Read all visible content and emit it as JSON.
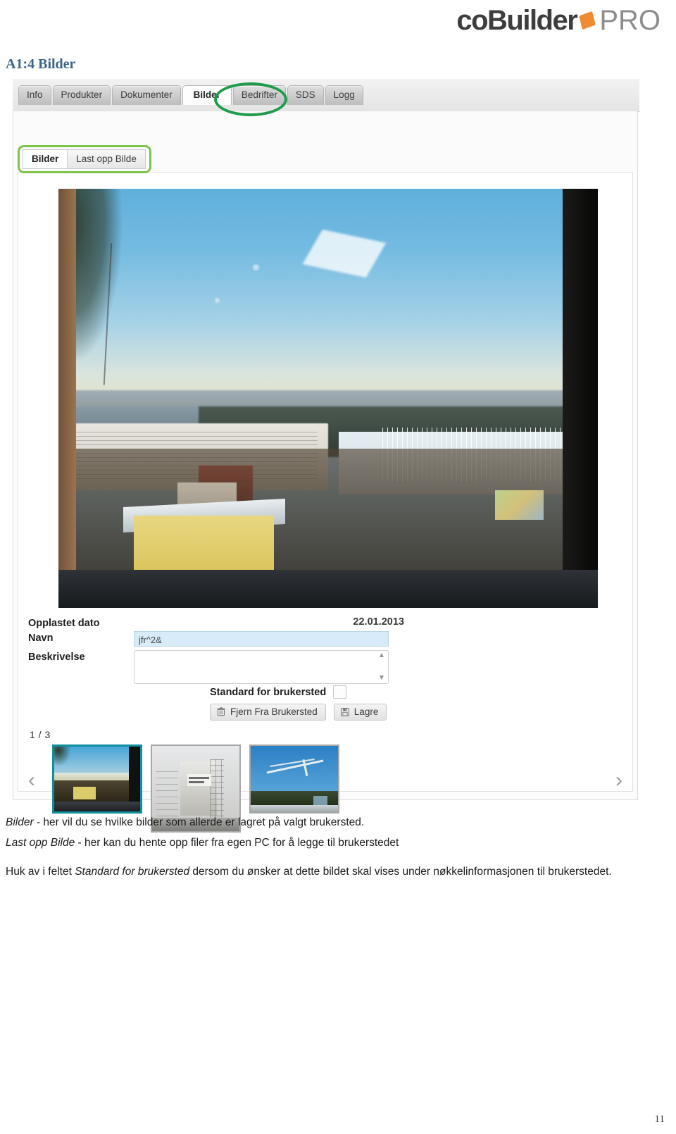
{
  "brand": {
    "main": "coBuilder",
    "pro": "PRO",
    "diamond_color": "#f08a33",
    "main_color": "#3d3d3d",
    "pro_color": "#8d8d8d"
  },
  "heading": "A1:4 Bilder",
  "heading_color": "#3c6388",
  "app": {
    "main_tabs": [
      {
        "label": "Info",
        "active": false
      },
      {
        "label": "Produkter",
        "active": false
      },
      {
        "label": "Dokumenter",
        "active": false
      },
      {
        "label": "Bilder",
        "active": true
      },
      {
        "label": "Bedrifter",
        "active": false
      },
      {
        "label": "SDS",
        "active": false
      },
      {
        "label": "Logg",
        "active": false
      }
    ],
    "highlight_color": "#1f9c4b",
    "sub_highlight_color": "#7ec34a",
    "sub_tabs": [
      {
        "label": "Bilder",
        "active": true
      },
      {
        "label": "Last opp Bilde",
        "active": false
      }
    ],
    "form": {
      "uploaded_date_label": "Opplastet dato",
      "uploaded_date_value": "22.01.2013",
      "name_label": "Navn",
      "name_value": "jfr^2&",
      "description_label": "Beskrivelse",
      "description_value": "",
      "default_checkbox_label": "Standard for brukersted",
      "default_checkbox_checked": false,
      "scroll_up": "▲",
      "scroll_down": "▼"
    },
    "buttons": {
      "remove_label": "Fjern Fra Brukersted",
      "save_label": "Lagre"
    },
    "gallery": {
      "counter": "1 / 3",
      "prev_glyph": "‹",
      "next_glyph": "›",
      "thumbnails": [
        {
          "alt": "Utsikt fra vindu",
          "selected": true
        },
        {
          "alt": "Bygning med stillas",
          "selected": false
        },
        {
          "alt": "Byggekran mot blå himmel",
          "selected": false
        }
      ]
    }
  },
  "caption": {
    "line1_em": "Bilder",
    "line1_rest": " - her vil du se hvilke bilder som allerde er lagret på valgt brukersted.",
    "line2_em": "Last opp Bilde",
    "line2_rest": " - her kan du hente opp filer fra egen PC  for å legge til brukerstedet",
    "line3_pre": "Huk av i feltet ",
    "line3_em": "Standard for brukersted",
    "line3_post": " dersom du ønsker at dette bildet skal vises under nøkkelinformasjonen til brukerstedet."
  },
  "page_number": "11"
}
